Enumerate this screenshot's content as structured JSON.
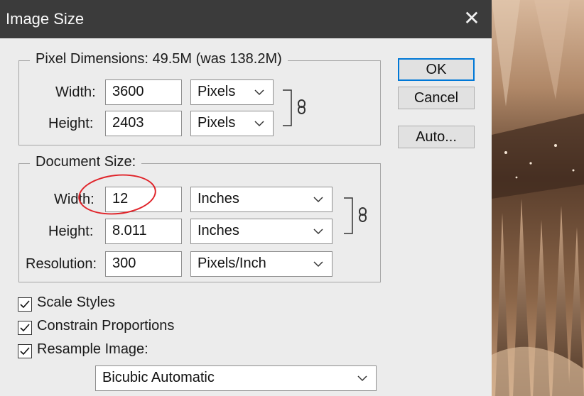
{
  "window": {
    "title": "Image Size",
    "close_glyph": "✕"
  },
  "buttons": {
    "ok": "OK",
    "cancel": "Cancel",
    "auto": "Auto..."
  },
  "pixel_dimensions": {
    "legend": "Pixel Dimensions:  49.5M (was 138.2M)",
    "width_label": "Width:",
    "width_value": "3600",
    "width_unit": "Pixels",
    "height_label": "Height:",
    "height_value": "2403",
    "height_unit": "Pixels"
  },
  "document_size": {
    "legend": "Document Size:",
    "width_label": "Width:",
    "width_value": "12",
    "width_unit": "Inches",
    "height_label": "Height:",
    "height_value": "8.011",
    "height_unit": "Inches",
    "resolution_label": "Resolution:",
    "resolution_value": "300",
    "resolution_unit": "Pixels/Inch"
  },
  "options": {
    "scale_styles": {
      "label": "Scale Styles",
      "checked": true
    },
    "constrain_proportions": {
      "label": "Constrain Proportions",
      "checked": true
    },
    "resample_image": {
      "label": "Resample Image:",
      "checked": true
    },
    "resample_method": "Bicubic Automatic"
  },
  "colors": {
    "titlebar": "#3b3b3b",
    "dialog_bg": "#ececec",
    "default_button_border": "#0078d7",
    "annotation_circle": "#e0242a",
    "photo_tone": "#7a5a42"
  },
  "icons": {
    "close": "close-icon",
    "link": "chain-link-icon",
    "dropdown": "chevron-down-icon",
    "checkmark": "checkmark-icon"
  }
}
